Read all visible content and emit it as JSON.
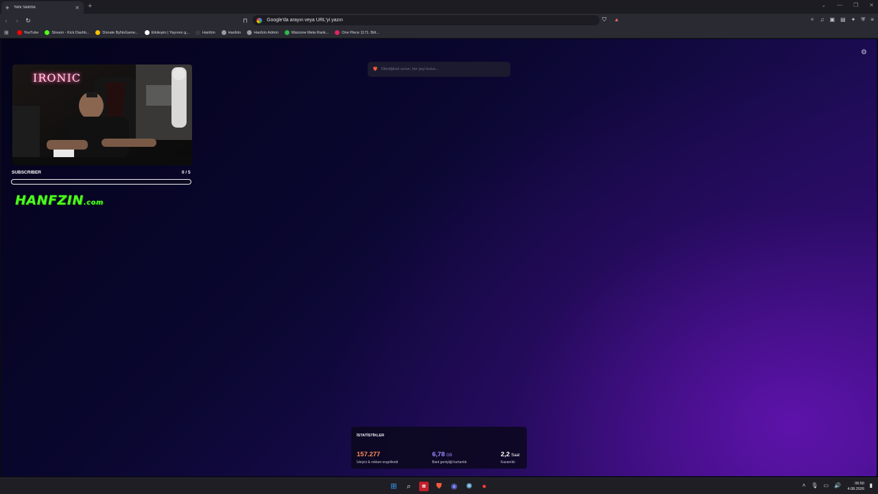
{
  "browser": {
    "tab_title": "Yeni Sekme",
    "address_placeholder": "Google'da arayın veya URL'yi yazın",
    "bookmarks": [
      {
        "label": "YouTube",
        "color": "#ff0000"
      },
      {
        "label": "Stream - Kick Dashb...",
        "color": "#53fc18"
      },
      {
        "label": "Donate ByNoGame...",
        "color": "#f5c400"
      },
      {
        "label": "Etkileşim | Yayınını g...",
        "color": "#ffffff"
      },
      {
        "label": "Hanfzin",
        "color": "#3a3a3a"
      },
      {
        "label": "Hanfzin",
        "color": "#9a9aa4"
      },
      {
        "label": "Hanfzin Admin",
        "color": "#9a9aa4"
      },
      {
        "label": "Warzone Meta Rank...",
        "color": "#2db84a"
      },
      {
        "label": "One Piece 1171. Böl...",
        "color": "#e0245e"
      }
    ]
  },
  "page": {
    "search_placeholder": "Dilediğinizi sorun, her şeyi bulun...",
    "widget": {
      "neon_sign": "IRONIC",
      "subscriber_label": "SUBSCRIBER",
      "subscriber_count": "0 / 5",
      "subscriber_progress": 0.0,
      "logo_main": "HANFZIN",
      "logo_tld": ".com"
    },
    "stats": {
      "title": "İSTATİSTİKLER",
      "items": [
        {
          "value": "157.277",
          "unit": "",
          "label": "İzleyici & reklam engellendi",
          "color": "#ff8a5a"
        },
        {
          "value": "6,78",
          "unit": "GB",
          "label": "Bant genişliği kurtarıldı",
          "color": "#9a8cff"
        },
        {
          "value": "2,2",
          "unit": "Saat",
          "label": "Kazanıldı",
          "color": "#ffffff"
        }
      ]
    }
  },
  "taskbar": {
    "time": "06:50",
    "date": "4.08.2026"
  },
  "colors": {
    "accent_green": "#4cff1e",
    "brave_orange": "#f05a3a"
  }
}
